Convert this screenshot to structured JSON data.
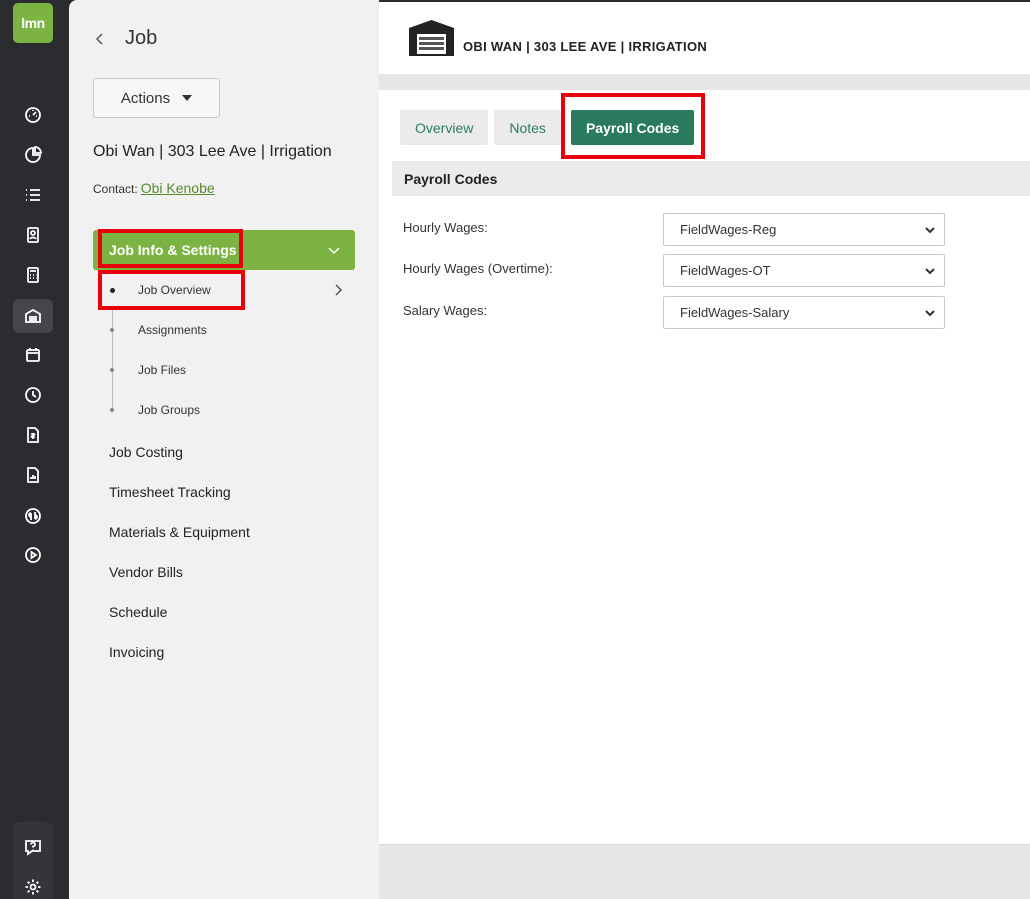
{
  "brand": {
    "logo_text": "lmn",
    "accent": "#7cb342",
    "tab_active": "#2a7a5e"
  },
  "rail": {
    "icons": [
      "dashboard-icon",
      "pie-chart-icon",
      "list-icon",
      "contacts-icon",
      "calculator-icon",
      "garage-icon",
      "calendar-icon",
      "clock-icon",
      "invoice-icon",
      "report-icon",
      "quickbooks-icon",
      "play-icon"
    ],
    "bottom_icons": [
      "help-icon",
      "settings-icon"
    ]
  },
  "side": {
    "title": "Job",
    "actions_label": "Actions",
    "job_name": "Obi Wan | 303 Lee Ave | Irrigation",
    "contact_label": "Contact:",
    "contact_name": "Obi Kenobe",
    "section_title": "Job Info & Settings",
    "sub_items": [
      "Job Overview",
      "Assignments",
      "Job Files",
      "Job Groups"
    ],
    "nav_items": [
      "Job Costing",
      "Timesheet Tracking",
      "Materials & Equipment",
      "Vendor Bills",
      "Schedule",
      "Invoicing"
    ]
  },
  "header": {
    "title": "OBI WAN | 303 LEE AVE | IRRIGATION"
  },
  "tabs": [
    "Overview",
    "Notes",
    "Payroll Codes"
  ],
  "active_tab": "Payroll Codes",
  "panel": {
    "title": "Payroll Codes",
    "fields": [
      {
        "label": "Hourly Wages:",
        "value": "FieldWages-Reg"
      },
      {
        "label": "Hourly Wages (Overtime):",
        "value": "FieldWages-OT"
      },
      {
        "label": "Salary Wages:",
        "value": "FieldWages-Salary"
      }
    ]
  }
}
